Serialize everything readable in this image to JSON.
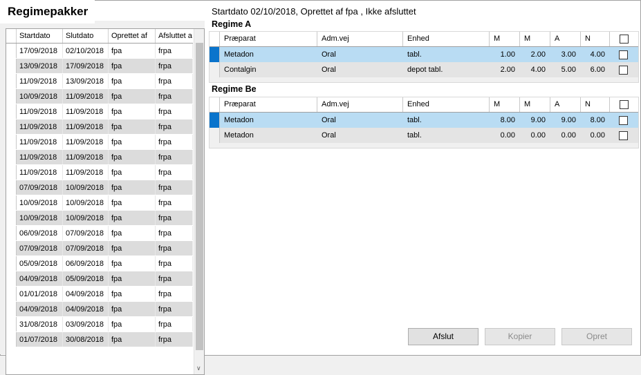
{
  "left": {
    "title": "Regimepakker",
    "columns": [
      "Startdato",
      "Slutdato",
      "Oprettet af",
      "Afsluttet a"
    ],
    "rows": [
      [
        "17/09/2018",
        "02/10/2018",
        "fpa",
        "frpa"
      ],
      [
        "13/09/2018",
        "17/09/2018",
        "fpa",
        "frpa"
      ],
      [
        "11/09/2018",
        "13/09/2018",
        "fpa",
        "frpa"
      ],
      [
        "10/09/2018",
        "11/09/2018",
        "fpa",
        "frpa"
      ],
      [
        "11/09/2018",
        "11/09/2018",
        "fpa",
        "frpa"
      ],
      [
        "11/09/2018",
        "11/09/2018",
        "fpa",
        "frpa"
      ],
      [
        "11/09/2018",
        "11/09/2018",
        "fpa",
        "frpa"
      ],
      [
        "11/09/2018",
        "11/09/2018",
        "fpa",
        "frpa"
      ],
      [
        "11/09/2018",
        "11/09/2018",
        "fpa",
        "frpa"
      ],
      [
        "07/09/2018",
        "10/09/2018",
        "fpa",
        "frpa"
      ],
      [
        "10/09/2018",
        "10/09/2018",
        "fpa",
        "frpa"
      ],
      [
        "10/09/2018",
        "10/09/2018",
        "fpa",
        "frpa"
      ],
      [
        "06/09/2018",
        "07/09/2018",
        "fpa",
        "frpa"
      ],
      [
        "07/09/2018",
        "07/09/2018",
        "fpa",
        "frpa"
      ],
      [
        "05/09/2018",
        "06/09/2018",
        "fpa",
        "frpa"
      ],
      [
        "04/09/2018",
        "05/09/2018",
        "fpa",
        "frpa"
      ],
      [
        "01/01/2018",
        "04/09/2018",
        "fpa",
        "frpa"
      ],
      [
        "04/09/2018",
        "04/09/2018",
        "fpa",
        "frpa"
      ],
      [
        "31/08/2018",
        "03/09/2018",
        "fpa",
        "frpa"
      ],
      [
        "01/07/2018",
        "30/08/2018",
        "fpa",
        "frpa"
      ]
    ]
  },
  "right": {
    "info": "Startdato 02/10/2018, Oprettet af fpa , Ikke afsluttet",
    "columns": [
      "Præparat",
      "Adm.vej",
      "Enhed",
      "M",
      "M",
      "A",
      "N"
    ],
    "regimes": [
      {
        "title": "Regime A",
        "rows": [
          {
            "selected": true,
            "praeparat": "Metadon",
            "admvej": "Oral",
            "enhed": "tabl.",
            "m1": "1.00",
            "m2": "2.00",
            "a": "3.00",
            "n": "4.00"
          },
          {
            "selected": false,
            "praeparat": "Contalgin",
            "admvej": "Oral",
            "enhed": "depot tabl.",
            "m1": "2.00",
            "m2": "4.00",
            "a": "5.00",
            "n": "6.00"
          }
        ]
      },
      {
        "title": "Regime Be",
        "rows": [
          {
            "selected": true,
            "praeparat": "Metadon",
            "admvej": "Oral",
            "enhed": "tabl.",
            "m1": "8.00",
            "m2": "9.00",
            "a": "9.00",
            "n": "8.00"
          },
          {
            "selected": false,
            "praeparat": "Metadon",
            "admvej": "Oral",
            "enhed": "tabl.",
            "m1": "0.00",
            "m2": "0.00",
            "a": "0.00",
            "n": "0.00"
          }
        ]
      }
    ]
  },
  "buttons": {
    "afslut": "Afslut",
    "kopier": "Kopier",
    "opret": "Opret"
  }
}
